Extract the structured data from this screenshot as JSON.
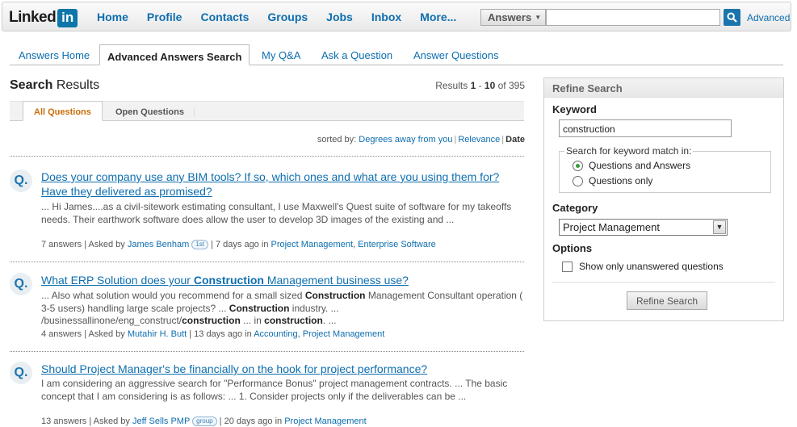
{
  "brand": {
    "linked": "Linked",
    "in": "in"
  },
  "nav": {
    "items": [
      "Home",
      "Profile",
      "Contacts",
      "Groups",
      "Jobs",
      "Inbox",
      "More..."
    ]
  },
  "search": {
    "scope": "Answers",
    "query": "",
    "advanced_label": "Advanced"
  },
  "tabs": [
    {
      "label": "Answers Home"
    },
    {
      "label": "Advanced Answers Search",
      "active": true
    },
    {
      "label": "My Q&A"
    },
    {
      "label": "Ask a Question"
    },
    {
      "label": "Answer Questions"
    }
  ],
  "results": {
    "title_bold": "Search",
    "title_rest": " Results",
    "count_prefix": "Results ",
    "range_start": "1",
    "range_sep": " - ",
    "range_end": "10",
    "of_label": " of ",
    "total": "395"
  },
  "subtabs": {
    "all": "All Questions",
    "open": "Open Questions"
  },
  "sort": {
    "prefix": "sorted by: ",
    "degrees": "Degrees away from you",
    "relevance": "Relevance",
    "date": "Date"
  },
  "items": [
    {
      "icon": "Q.",
      "title": "Does your company use any BIM tools? If so, which ones and what are you using them for? Have they delivered as promised?",
      "snippet_html": "... Hi James....as a civil-sitework estimating consultant, I use Maxwell's Quest suite of software for my takeoffs needs. Their earthwork software does allow the user to develop 3D images of the existing and ...",
      "answers": "7 answers",
      "asked_by_label": "Asked by",
      "author": "James Benham",
      "badge": "1st",
      "age": "7 days ago",
      "in_label": "in",
      "categories": [
        "Project Management",
        "Enterprise Software"
      ]
    },
    {
      "icon": "Q.",
      "title_parts": [
        "What ERP Solution does your ",
        "Construction",
        " Management business use?"
      ],
      "snippet_parts": [
        "... Also what solution would you recommend for a small sized ",
        "Construction",
        " Management Consultant operation ( 3-5 users) handling large scale projects? ... ",
        "Construction",
        " industry. ... /businessallinone/eng_construct/",
        "construction",
        " ... in ",
        "construction",
        ". ..."
      ],
      "answers": "4 answers",
      "asked_by_label": "Asked by",
      "author": "Mutahir H. Butt",
      "age": "13 days ago",
      "in_label": "in",
      "categories": [
        "Accounting",
        "Project Management"
      ]
    },
    {
      "icon": "Q.",
      "title": "Should Project Manager's be financially on the hook for project performance?",
      "snippet_html": "I am considering an aggressive search for \"Performance Bonus\" project management contracts. ... The basic concept that I am considering is as follows: ... 1. Consider projects only if the deliverables can be ...",
      "answers": "13 answers",
      "asked_by_label": "Asked by",
      "author": "Jeff Sells PMP",
      "badge": "group",
      "age": "20 days ago",
      "in_label": "in",
      "categories": [
        "Project Management"
      ]
    }
  ],
  "refine": {
    "heading": "Refine Search",
    "keyword_label": "Keyword",
    "keyword_value": "construction",
    "match_legend": "Search for keyword match in:",
    "match_options": [
      "Questions and Answers",
      "Questions only"
    ],
    "match_selected": "Questions and Answers",
    "category_label": "Category",
    "category_value": "Project Management",
    "options_label": "Options",
    "unanswered_label": "Show only unanswered questions",
    "button_label": "Refine Search"
  },
  "colors": {
    "link": "#0e6eaf",
    "brand": "#0e76a8",
    "active_subtab": "#c86f0a"
  }
}
